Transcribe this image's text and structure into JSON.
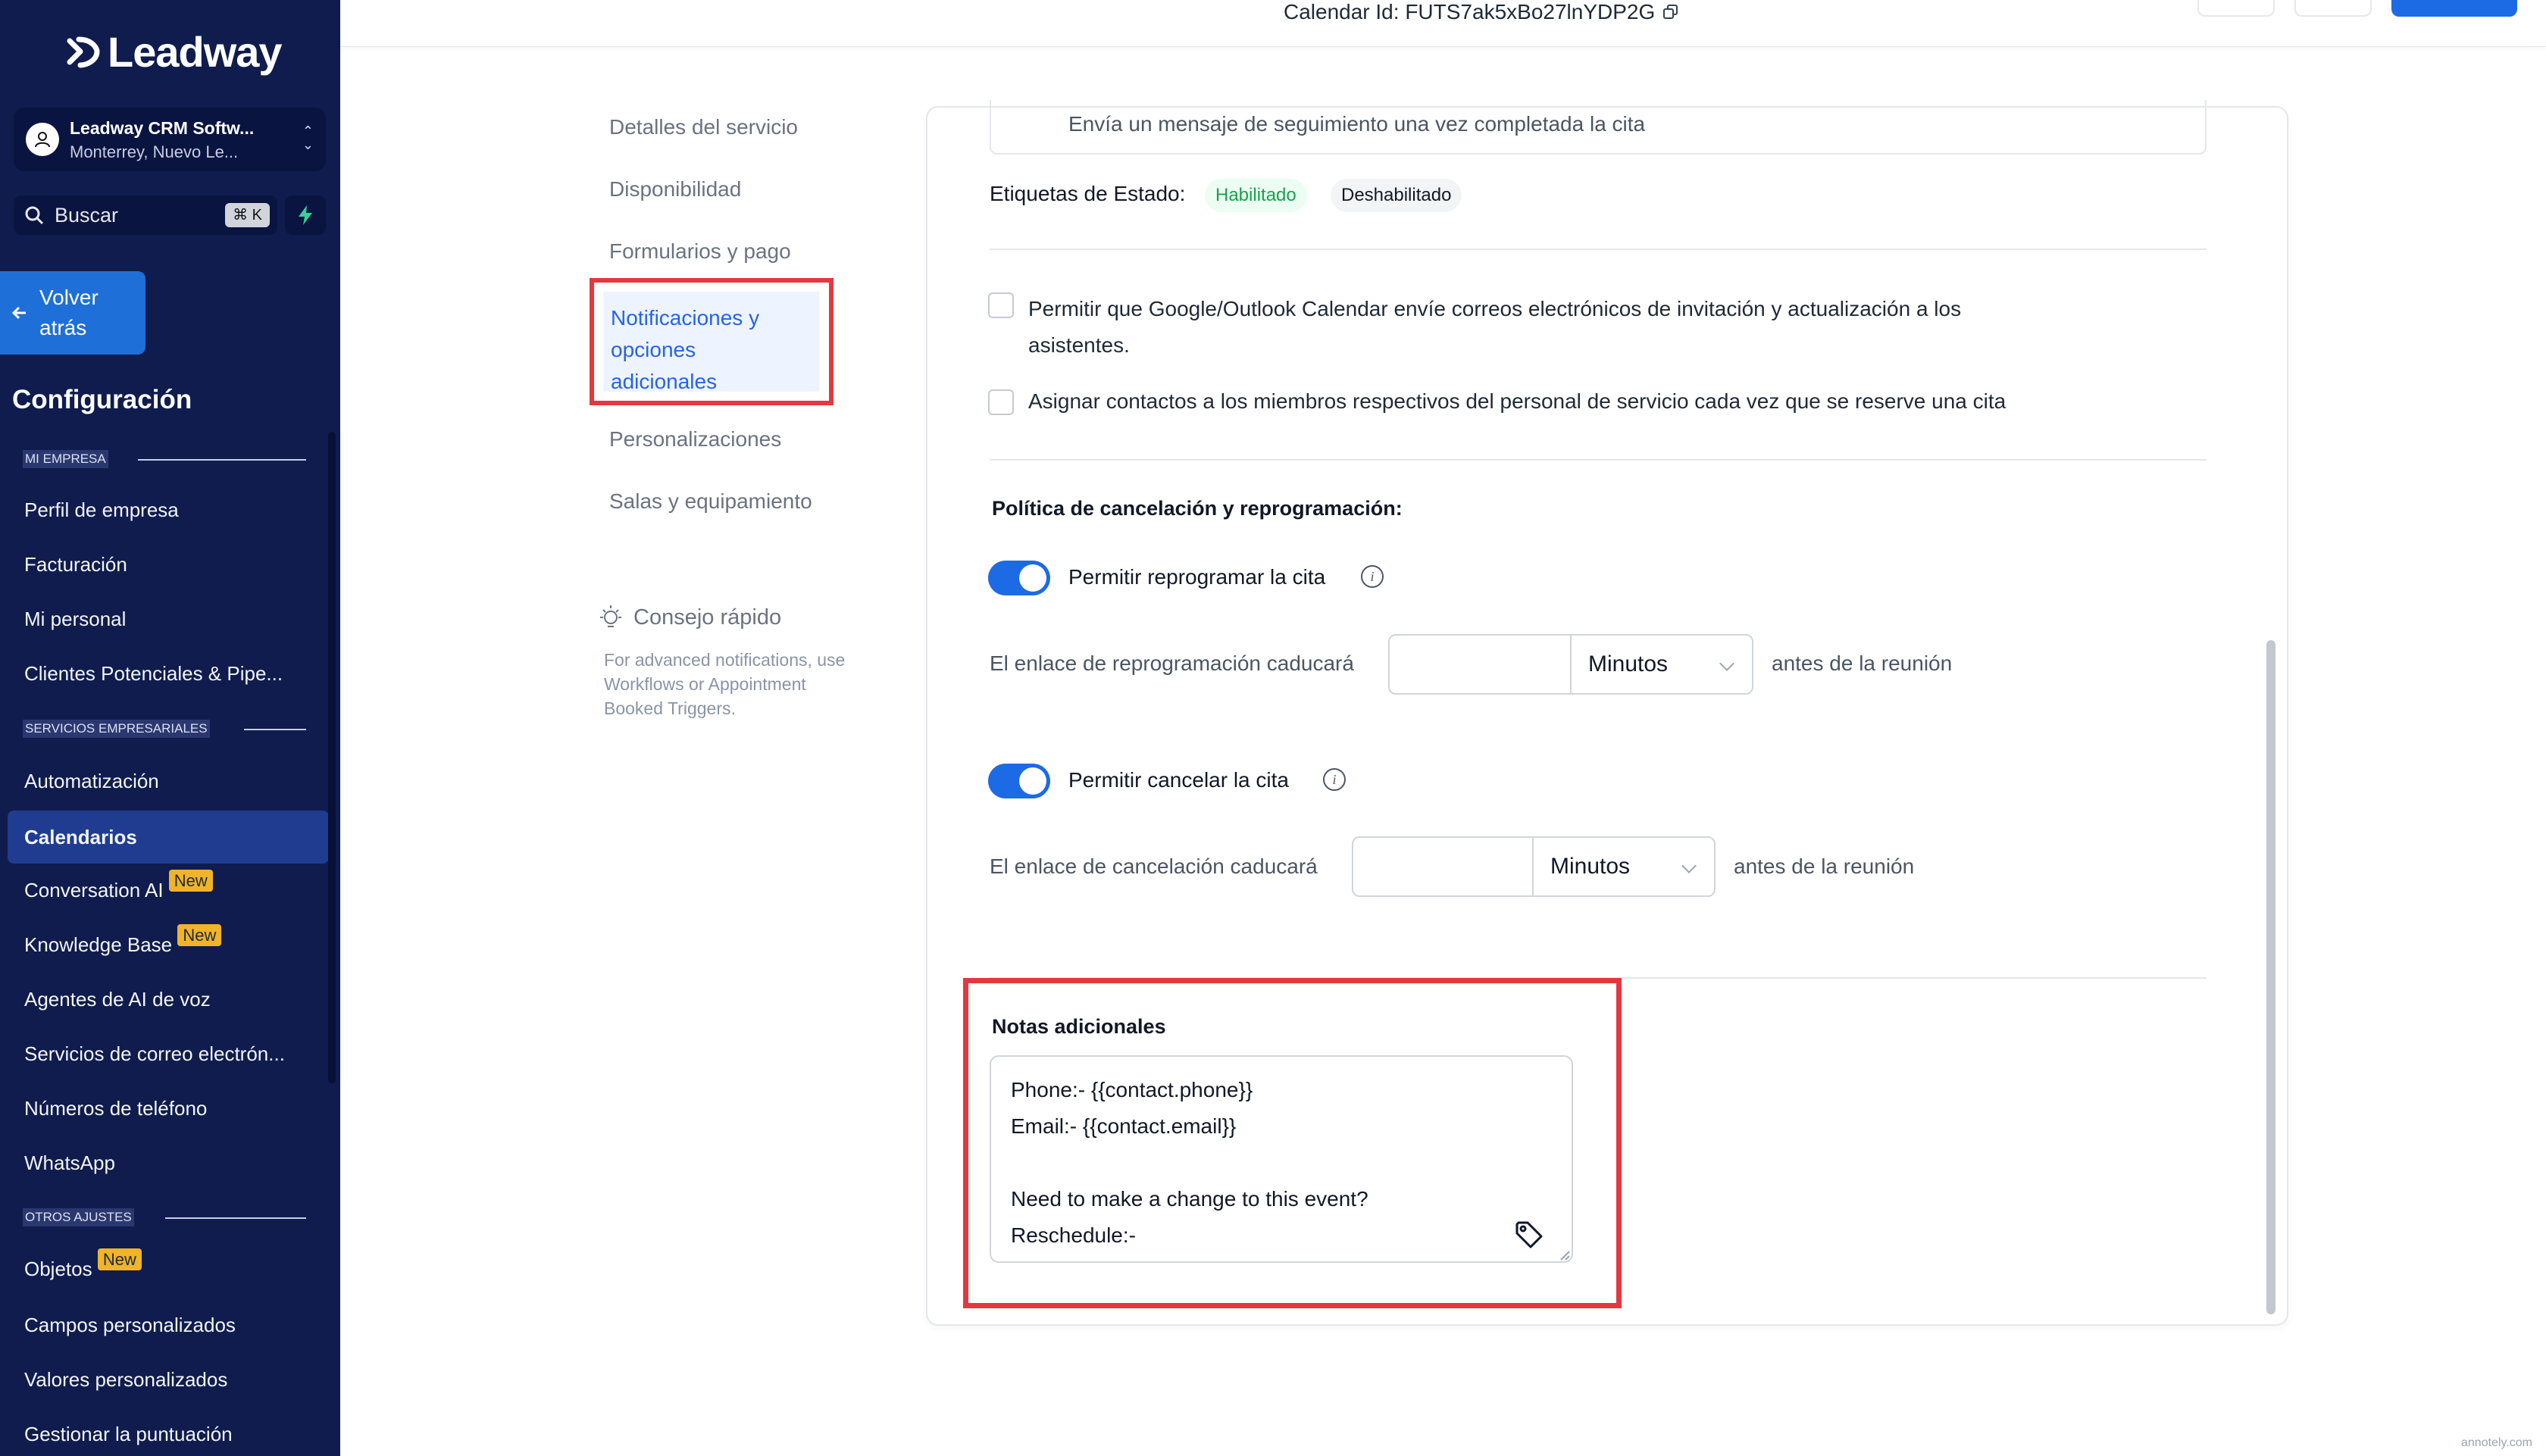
{
  "brand": {
    "name": "Leadway"
  },
  "account": {
    "name": "Leadway CRM Softw...",
    "location": "Monterrey, Nuevo Le..."
  },
  "search": {
    "label": "Buscar",
    "shortcut": "⌘ K"
  },
  "back": {
    "line1": "Volver",
    "line2": "atrás"
  },
  "sidebar": {
    "title": "Configuración",
    "sections": [
      {
        "label": "MI EMPRESA",
        "items": [
          "Perfil de empresa",
          "Facturación",
          "Mi personal",
          "Clientes Potenciales & Pipe..."
        ]
      },
      {
        "label": "SERVICIOS EMPRESARIALES",
        "items": [
          "Automatización",
          "Calendarios",
          "Conversation AI",
          "Knowledge Base",
          "Agentes de AI de voz",
          "Servicios de correo electrón...",
          "Números de teléfono",
          "WhatsApp"
        ]
      },
      {
        "label": "OTROS AJUSTES",
        "items": [
          "Objetos",
          "Campos personalizados",
          "Valores personalizados",
          "Gestionar la puntuación"
        ]
      }
    ],
    "active": "Calendarios",
    "badge": "New"
  },
  "topbar": {
    "calendar_id": "Calendar Id: FUTS7ak5xBo27lnYDP2G"
  },
  "subnav": {
    "items": [
      "Detalles del servicio",
      "Disponibilidad",
      "Formularios y pago",
      "Notificaciones y",
      "opciones",
      "adicionales",
      "Personalizaciones",
      "Salas y equipamiento"
    ],
    "active_index": 3
  },
  "tip": {
    "title": "Consejo rápido",
    "body": "For advanced notifications, use Workflows or Appointment Booked Triggers."
  },
  "form": {
    "followup_text": "Envía un mensaje de seguimiento una vez completada la cita",
    "status_tags_label": "Etiquetas de Estado:",
    "tag_enabled": "Habilitado",
    "tag_disabled": "Deshabilitado",
    "checkbox1_line1": "Permitir que Google/Outlook Calendar envíe correos electrónicos de invitación y actualización a los",
    "checkbox1_line2": "asistentes.",
    "checkbox1_checked": false,
    "checkbox2": "Asignar contactos a los miembros respectivos del personal de servicio cada vez que se reserve una cita",
    "checkbox2_checked": false,
    "policy_title": "Política de cancelación y reprogramación:",
    "reschedule_toggle_label": "Permitir reprogramar la cita",
    "reschedule_on": true,
    "reschedule_link_label": "El enlace de reprogramación caducará",
    "reschedule_unit": "Minutos",
    "reschedule_suffix": "antes de la reunión",
    "cancel_toggle_label": "Permitir cancelar la cita",
    "cancel_on": true,
    "cancel_link_label": "El enlace de cancelación caducará",
    "cancel_unit": "Minutos",
    "cancel_suffix": "antes de la reunión",
    "notes_label": "Notas adicionales",
    "notes_value": "Phone:- {{contact.phone}}\nEmail:- {{contact.email}}\n\nNeed to make a change to this event?\nReschedule:-\n{{reschedule_link}}"
  },
  "watermark": "annotely.com",
  "colors": {
    "accent": "#1d6ae5",
    "highlight": "#e3383f",
    "sidebar": "#0f1c4d",
    "badge": "#f0b429"
  }
}
